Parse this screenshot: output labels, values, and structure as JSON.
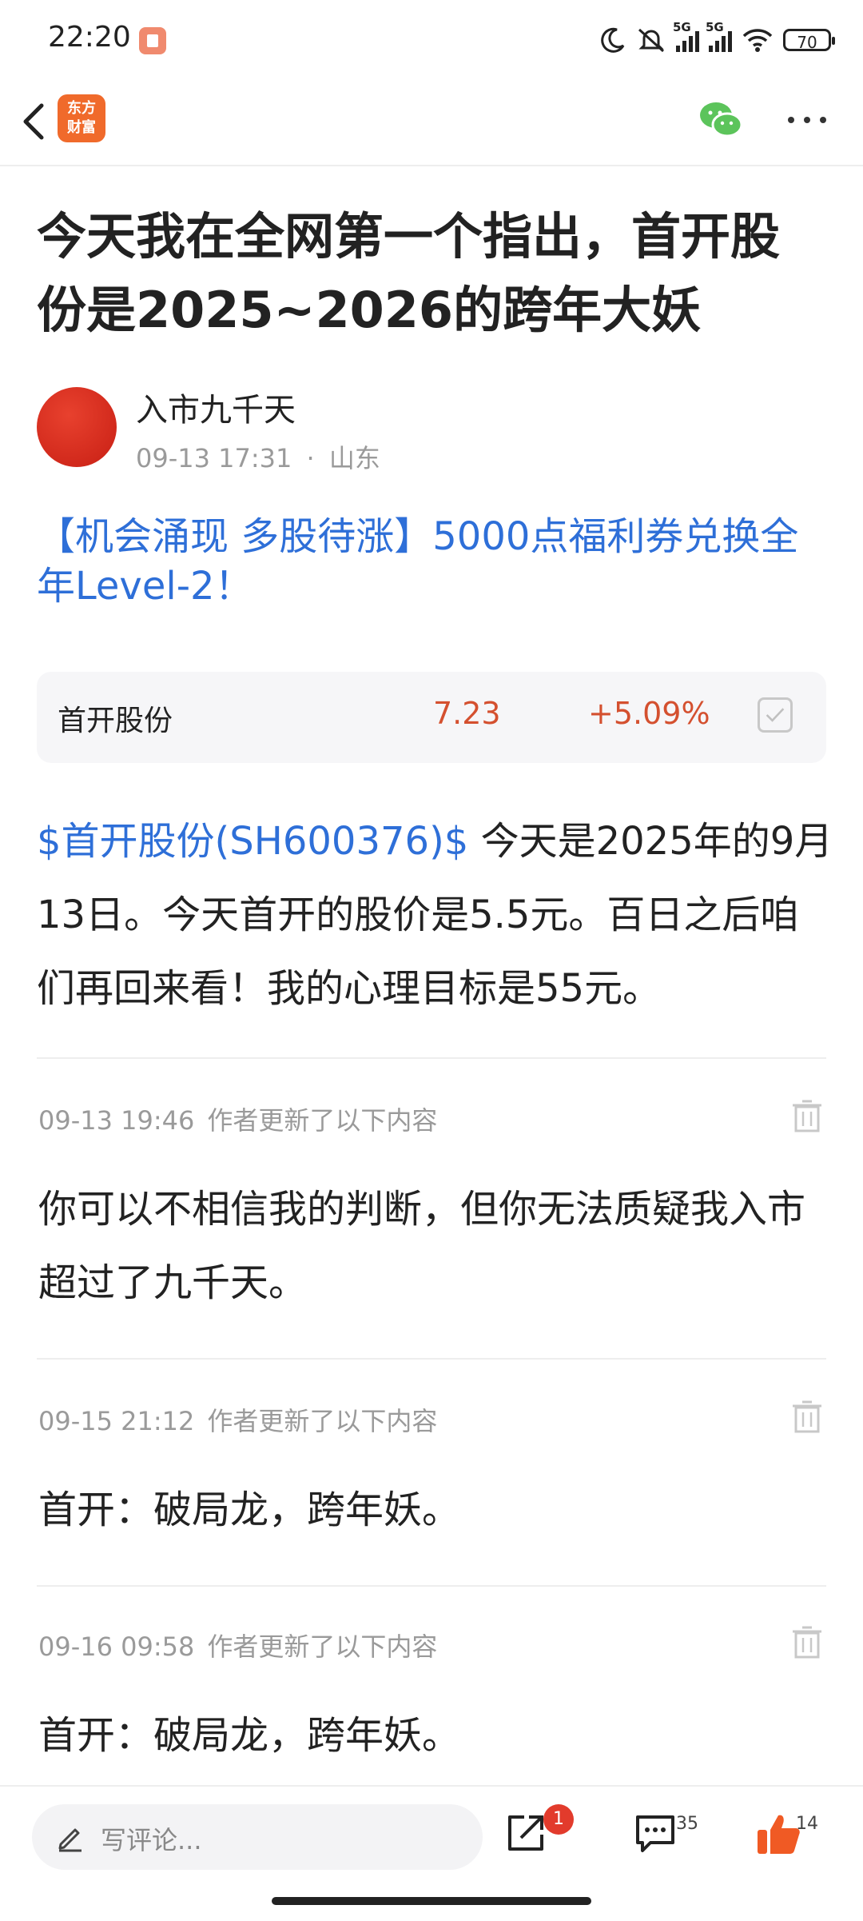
{
  "status_bar": {
    "time": "22:20",
    "net1": "5G",
    "net2": "5G",
    "battery": "70"
  },
  "nav": {
    "logo_line1": "东方",
    "logo_line2": "财富"
  },
  "article": {
    "title": "今天我在全网第一个指出，首开股份是2025~2026的跨年大妖",
    "author": "入市九千天",
    "date": "09-13 17:31",
    "sep": "·",
    "location": "山东",
    "promo": "【机会涌现 多股待涨】5000点福利券兑换全年Level-2！",
    "stock": {
      "name": "首开股份",
      "price": "7.23",
      "change": "+5.09%"
    },
    "body_tag": "$首开股份(SH600376)$",
    "body_text": "  今天是2025年的9月13日。今天首开的股价是5.5元。百日之后咱们再回来看！我的心理目标是55元。"
  },
  "updates": [
    {
      "time": "09-13 19:46",
      "label": "作者更新了以下内容",
      "text": "你可以不相信我的判断，但你无法质疑我入市超过了九千天。"
    },
    {
      "time": "09-15 21:12",
      "label": "作者更新了以下内容",
      "text": "首开：破局龙，跨年妖。"
    },
    {
      "time": "09-16 09:58",
      "label": "作者更新了以下内容",
      "text": "首开：破局龙，跨年妖。"
    }
  ],
  "bottom_bar": {
    "comment_placeholder": "写评论...",
    "share_badge": "1",
    "comments_count": "35",
    "likes_count": "14"
  },
  "colors": {
    "accent_link": "#2e6fd8",
    "stock_up": "#d4502f",
    "like": "#f05a24",
    "badge": "#e23b2c"
  }
}
